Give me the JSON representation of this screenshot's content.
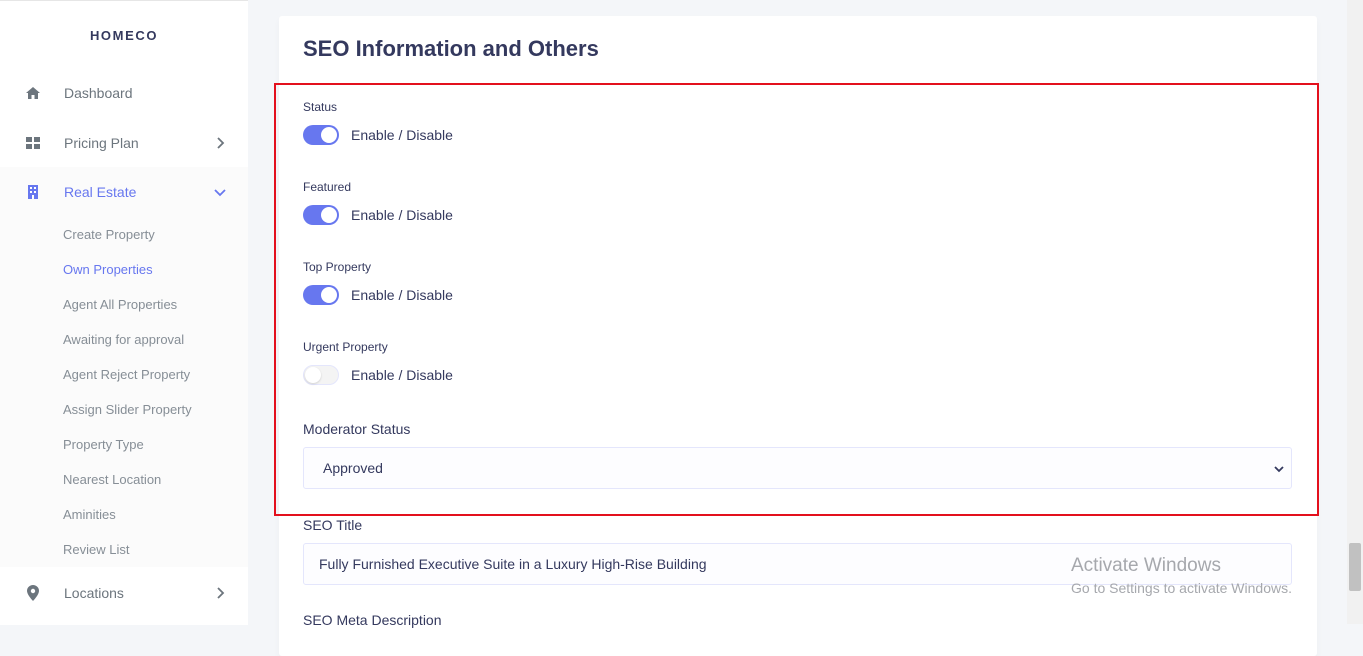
{
  "brand": "HOMECO",
  "sidebar": {
    "items": [
      {
        "label": "Dashboard",
        "icon": "home-icon"
      },
      {
        "label": "Pricing Plan",
        "icon": "grid-icon",
        "chevron": "chevron-right"
      },
      {
        "label": "Real Estate",
        "icon": "building-icon",
        "chevron": "chevron-down",
        "active": true
      },
      {
        "label": "Locations",
        "icon": "map-pin-icon",
        "chevron": "chevron-right"
      }
    ],
    "submenu": [
      "Create Property",
      "Own Properties",
      "Agent All Properties",
      "Awaiting for approval",
      "Agent Reject Property",
      "Assign Slider Property",
      "Property Type",
      "Nearest Location",
      "Aminities",
      "Review List"
    ],
    "active_submenu": "Own Properties"
  },
  "main": {
    "title": "SEO Information and Others",
    "toggles": [
      {
        "label": "Status",
        "text": "Enable / Disable",
        "on": true
      },
      {
        "label": "Featured",
        "text": "Enable / Disable",
        "on": true
      },
      {
        "label": "Top Property",
        "text": "Enable / Disable",
        "on": true
      },
      {
        "label": "Urgent Property",
        "text": "Enable / Disable",
        "on": false
      }
    ],
    "moderator_status": {
      "label": "Moderator Status",
      "value": "Approved"
    },
    "seo_title": {
      "label": "SEO Title",
      "value": "Fully Furnished Executive Suite in a Luxury High-Rise Building"
    },
    "seo_meta_label": "SEO Meta Description"
  },
  "watermark": {
    "line1": "Activate Windows",
    "line2": "Go to Settings to activate Windows."
  },
  "colors": {
    "accent": "#6777ef",
    "highlight": "#e3101d"
  }
}
